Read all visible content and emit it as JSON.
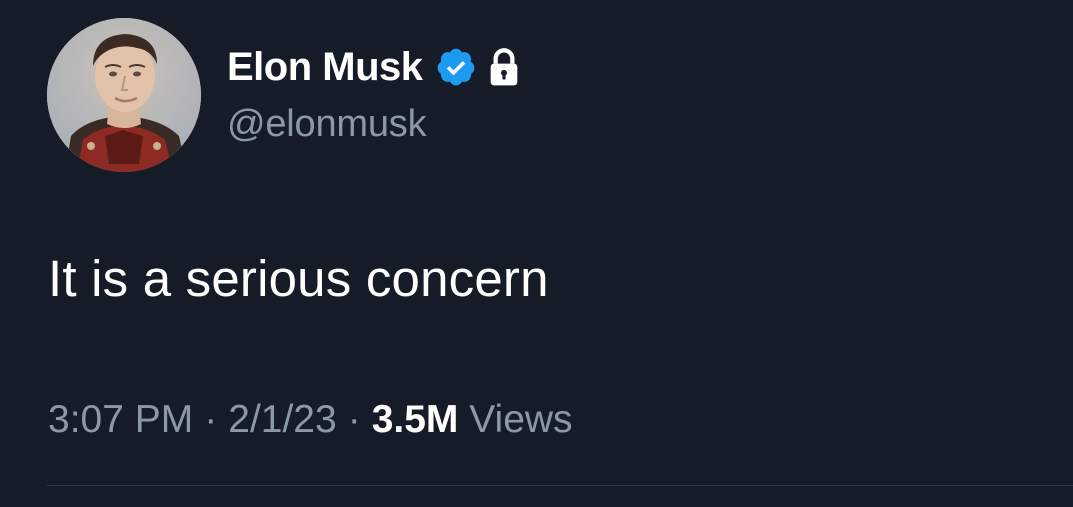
{
  "author": {
    "display_name": "Elon Musk",
    "handle": "@elonmusk",
    "verified": true,
    "protected": true,
    "avatar_icon": "profile-photo"
  },
  "tweet": {
    "text": "It is a serious concern"
  },
  "meta": {
    "time": "3:07 PM",
    "separator": "·",
    "date": "2/1/23",
    "views_count": "3.5M",
    "views_label": "Views"
  },
  "colors": {
    "background": "#161c27",
    "primary_text": "#ffffff",
    "secondary_text": "#8b98a5",
    "verified_badge": "#1d9bf0",
    "divider": "#2f3640"
  }
}
